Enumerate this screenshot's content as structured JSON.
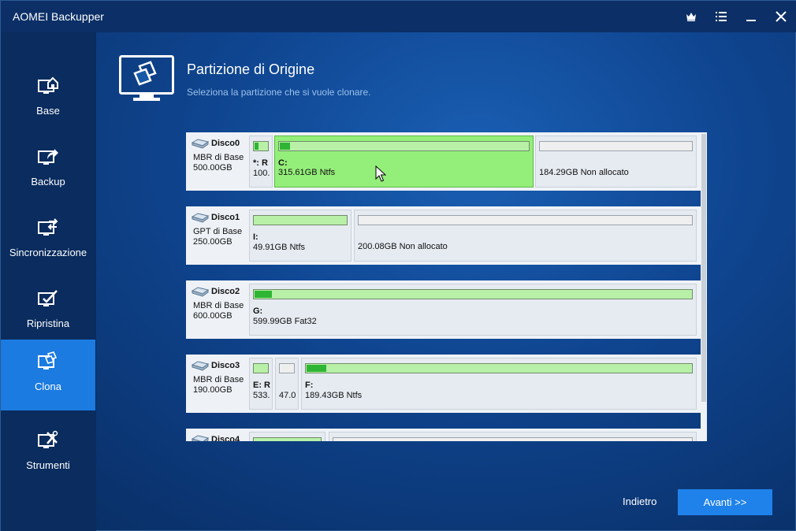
{
  "app": {
    "title": "AOMEI Backupper"
  },
  "titlebar": {
    "icons": [
      "crown-icon",
      "menu-icon",
      "minimize-icon",
      "close-icon"
    ]
  },
  "sidebar": {
    "items": [
      {
        "label": "Base",
        "icon": "home-monitor-icon",
        "active": false
      },
      {
        "label": "Backup",
        "icon": "backup-arrow-icon",
        "active": false
      },
      {
        "label": "Sincronizzazione",
        "icon": "sync-arrows-icon",
        "active": false
      },
      {
        "label": "Ripristina",
        "icon": "restore-check-icon",
        "active": false
      },
      {
        "label": "Clona",
        "icon": "clone-icon",
        "active": true
      },
      {
        "label": "Strumenti",
        "icon": "tools-icon",
        "active": false
      }
    ]
  },
  "header": {
    "title": "Partizione di Origine",
    "subtitle": "Seleziona la partizione che si vuole clonare."
  },
  "disks": [
    {
      "name": "Disco0",
      "type": "MBR di Base",
      "size": "500.00GB",
      "partitions": [
        {
          "letter": "*: R",
          "desc": "100.",
          "used": 0.25,
          "allocated": true
        },
        {
          "letter": "C:",
          "desc": "315.61GB Ntfs",
          "used": 0.03,
          "allocated": true,
          "selected": true
        },
        {
          "letter": "",
          "desc": "184.29GB Non allocato",
          "used": 0,
          "allocated": false
        }
      ]
    },
    {
      "name": "Disco1",
      "type": "GPT di Base",
      "size": "250.00GB",
      "partitions": [
        {
          "letter": "I:",
          "desc": "49.91GB Ntfs",
          "used": 0.0,
          "allocated": true
        },
        {
          "letter": "",
          "desc": "200.08GB Non allocato",
          "used": 0,
          "allocated": false
        }
      ]
    },
    {
      "name": "Disco2",
      "type": "MBR di Base",
      "size": "600.00GB",
      "partitions": [
        {
          "letter": "G:",
          "desc": "599.99GB Fat32",
          "used": 0.01,
          "allocated": true
        }
      ]
    },
    {
      "name": "Disco3",
      "type": "MBR di Base",
      "size": "190.00GB",
      "partitions": [
        {
          "letter": "E: R",
          "desc": "533.",
          "used": 0.0,
          "allocated": true
        },
        {
          "letter": "",
          "desc": "47.0",
          "used": 0,
          "allocated": false
        },
        {
          "letter": "F:",
          "desc": "189.43GB Ntfs",
          "used": 0.05,
          "allocated": true
        }
      ]
    },
    {
      "name": "Disco4",
      "type": "",
      "size": "",
      "partitions": [
        {
          "letter": "",
          "desc": "",
          "used": 0.0,
          "allocated": true
        },
        {
          "letter": "",
          "desc": "",
          "used": 0,
          "allocated": false
        }
      ]
    }
  ],
  "footer": {
    "back_label": "Indietro",
    "next_label": "Avanti >>"
  },
  "colors": {
    "accent": "#1f82ea",
    "selected": "#94ee7a",
    "used_fill": "#2fb534",
    "sidebar_active": "#1b7be0"
  }
}
